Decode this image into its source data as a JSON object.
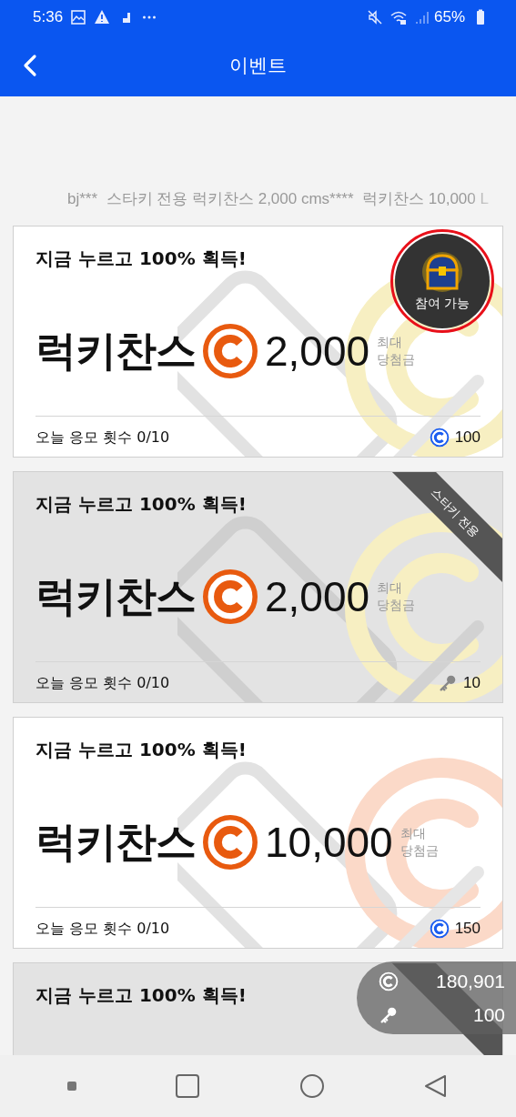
{
  "status_bar": {
    "time": "5:36",
    "battery": "65%"
  },
  "app_bar": {
    "title": "이벤트"
  },
  "ticker": {
    "text": "bj***  스타키 전용 럭키찬스 2,000 cms****  럭키찬스 10,000 L"
  },
  "cards": [
    {
      "title": "지금 누르고 100% 획득!",
      "name": "럭키찬스",
      "amount": "2,000",
      "prize_label": "최대 당첨금",
      "counter": "오늘 응모 횟수 0/10",
      "cost": {
        "kind": "coin",
        "value": "100"
      },
      "exclusive": false,
      "badge": {
        "label": "참여 가능",
        "highlighted": true
      }
    },
    {
      "title": "지금 누르고 100% 획득!",
      "name": "럭키찬스",
      "amount": "2,000",
      "prize_label": "최대 당첨금",
      "counter": "오늘 응모 횟수 0/10",
      "cost": {
        "kind": "key",
        "value": "10"
      },
      "exclusive": true,
      "ribbon": "스타키 전용"
    },
    {
      "title": "지금 누르고 100% 획득!",
      "name": "럭키찬스",
      "amount": "10,000",
      "prize_label": "최대 당첨금",
      "counter": "오늘 응모 횟수 0/10",
      "cost": {
        "kind": "coin",
        "value": "150"
      },
      "exclusive": false
    },
    {
      "title": "지금 누르고 100% 획득!",
      "exclusive": true
    }
  ],
  "wallet": {
    "coins": "180,901",
    "keys": "100"
  }
}
